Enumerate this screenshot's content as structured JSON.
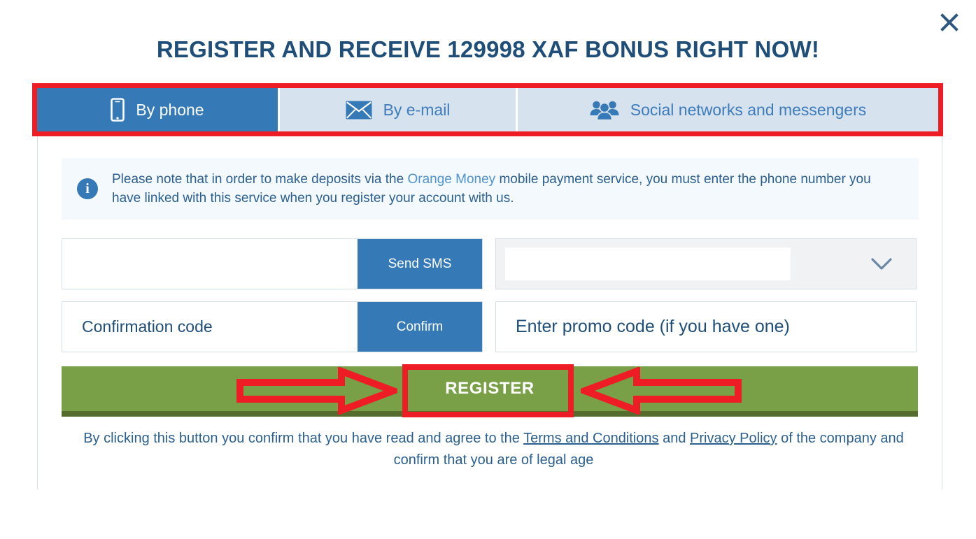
{
  "modal": {
    "title": "REGISTER AND RECEIVE 129998 XAF BONUS RIGHT NOW!",
    "close_label": "×"
  },
  "tabs": [
    {
      "label": "By phone",
      "icon": "smartphone-icon",
      "active": true
    },
    {
      "label": "By e-mail",
      "icon": "envelope-icon",
      "active": false
    },
    {
      "label": "Social networks and messengers",
      "icon": "users-group-icon",
      "active": false
    }
  ],
  "notice": {
    "icon": "info-icon",
    "text_before": "Please note that in order to make deposits via the ",
    "link": "Orange Money",
    "text_after": " mobile payment service, you must enter the phone number you have linked with this service when you register your account with us."
  },
  "form": {
    "phone": {
      "value": "",
      "placeholder": ""
    },
    "send_sms_label": "Send SMS",
    "currency": {
      "value": "",
      "placeholder": "",
      "icon": "chevron-down-icon"
    },
    "confirmation": {
      "value": "",
      "placeholder": "Confirmation code"
    },
    "confirm_label": "Confirm",
    "promo": {
      "value": "",
      "placeholder": "Enter promo code (if you have one)"
    },
    "register_label": "REGISTER"
  },
  "footer": {
    "text_1": "By clicking this button you confirm that you have read and agree to the ",
    "terms_link": "Terms and Conditions",
    "text_2": " and ",
    "privacy_link": "Privacy Policy",
    "text_3": " of the company and confirm that you are of legal age"
  },
  "colors": {
    "brand_blue": "#3579b6",
    "title_navy": "#1f4e79",
    "tab_inactive": "#d6e3ee",
    "green": "#79a047",
    "green_dark": "#566c2c",
    "annotation_red": "#ee1c25",
    "notice_bg": "#f4f9fd"
  }
}
